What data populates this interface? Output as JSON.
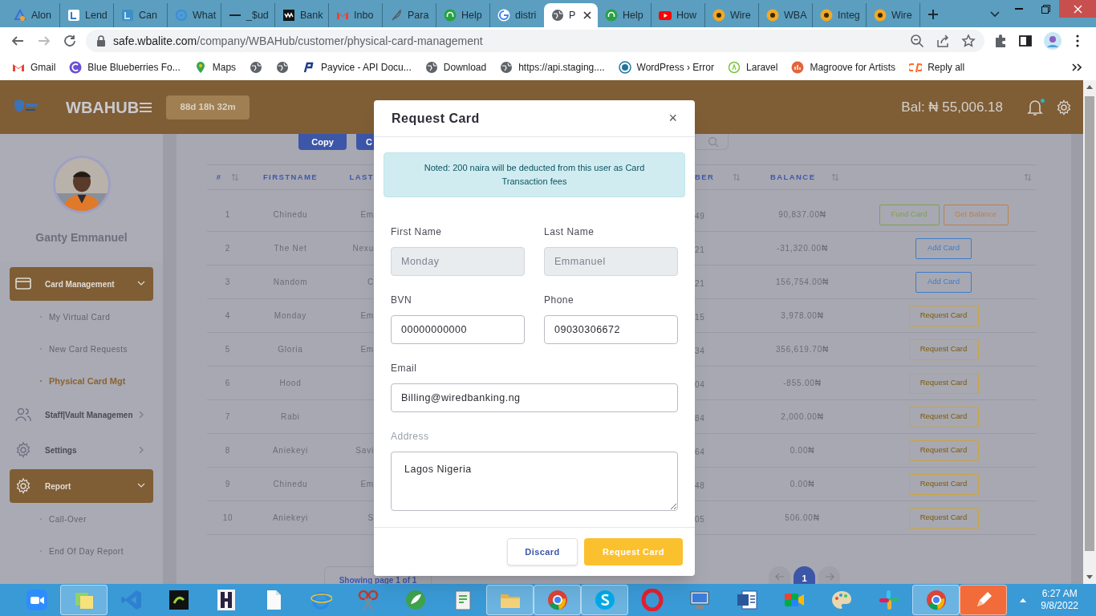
{
  "browser": {
    "tabs": [
      {
        "title": "Alon",
        "selected": false
      },
      {
        "title": "Lend",
        "selected": false
      },
      {
        "title": "Can",
        "selected": false
      },
      {
        "title": "What",
        "selected": false
      },
      {
        "title": "_$ud",
        "selected": false
      },
      {
        "title": "Bank",
        "selected": false
      },
      {
        "title": "Inbo",
        "selected": false
      },
      {
        "title": "Para",
        "selected": false
      },
      {
        "title": "Help",
        "selected": false
      },
      {
        "title": "distri",
        "selected": false
      },
      {
        "title": "P",
        "selected": true
      },
      {
        "title": "Help",
        "selected": false
      },
      {
        "title": "How",
        "selected": false
      },
      {
        "title": "Wire",
        "selected": false
      },
      {
        "title": "WBA",
        "selected": false
      },
      {
        "title": "Integ",
        "selected": false
      },
      {
        "title": "Wire",
        "selected": false
      }
    ],
    "url": {
      "host": "safe.wbalite.com",
      "path": "/company/WBAHub/customer/physical-card-management"
    },
    "bookmarks": [
      {
        "kind": "link",
        "label": "Gmail"
      },
      {
        "kind": "link",
        "label": "Blue Blueberries Fo..."
      },
      {
        "kind": "link",
        "label": "Maps"
      },
      {
        "kind": "icon"
      },
      {
        "kind": "icon"
      },
      {
        "kind": "link",
        "label": "Payvice - API Docu..."
      },
      {
        "kind": "link",
        "label": "Download"
      },
      {
        "kind": "link",
        "label": "https://api.staging...."
      },
      {
        "kind": "link",
        "label": "WordPress › Error"
      },
      {
        "kind": "link",
        "label": "Laravel"
      },
      {
        "kind": "link",
        "label": "Magroove for Artists"
      },
      {
        "kind": "link",
        "label": "Reply all"
      }
    ]
  },
  "app": {
    "brand": "WBAHUB",
    "timer": "88d 18h 32m",
    "balance": "Bal: ₦ 55,006.18",
    "notification": true
  },
  "sidebar": {
    "user": "Ganty Emmanuel",
    "items": [
      {
        "label": "Card Management",
        "expanded": true,
        "children": [
          {
            "label": "My Virtual Card",
            "selected": false
          },
          {
            "label": "New Card Requests",
            "selected": false
          },
          {
            "label": "Physical Card Mgt",
            "selected": true
          }
        ]
      },
      {
        "label": "Staff|Vault Managemen",
        "expanded": false
      },
      {
        "label": "Settings",
        "expanded": false
      },
      {
        "label": "Report",
        "expanded": true,
        "children": [
          {
            "label": "Call-Over",
            "selected": false
          },
          {
            "label": "End Of Day Report",
            "selected": false
          }
        ]
      }
    ]
  },
  "toolbar": {
    "buttons": [
      "Copy",
      "C"
    ]
  },
  "table": {
    "columns": [
      "#",
      "FIRSTNAME",
      "LAST",
      "BER",
      "BALANCE"
    ],
    "rows": [
      {
        "no": "1",
        "firstname": "Chinedu",
        "lastname": "Em",
        "column_4": "49",
        "balance": "90,837.00₦",
        "actions": [
          {
            "kind": "fund",
            "label": "Fund Card"
          },
          {
            "kind": "balance",
            "label": "Get Balance"
          }
        ]
      },
      {
        "no": "2",
        "firstname": "The Net",
        "lastname": "Nexu",
        "column_4": "21",
        "balance": "-31,320.00₦",
        "actions": [
          {
            "kind": "add",
            "label": "Add Card"
          }
        ]
      },
      {
        "no": "3",
        "firstname": "Nandom",
        "lastname": "C",
        "column_4": "21",
        "balance": "156,754.00₦",
        "actions": [
          {
            "kind": "add",
            "label": "Add Card"
          }
        ]
      },
      {
        "no": "4",
        "firstname": "Monday",
        "lastname": "Em",
        "column_4": "15",
        "balance": "3,978.00₦",
        "actions": [
          {
            "kind": "request",
            "label": "Request Card"
          }
        ]
      },
      {
        "no": "5",
        "firstname": "Gloria",
        "lastname": "Em",
        "column_4": "34",
        "balance": "356,619.70₦",
        "actions": [
          {
            "kind": "request",
            "label": "Request Card"
          }
        ]
      },
      {
        "no": "6",
        "firstname": "Hood",
        "column_4": "04",
        "balance": "-855.00₦",
        "actions": [
          {
            "kind": "request",
            "label": "Request Card"
          }
        ]
      },
      {
        "no": "7",
        "firstname": "Rabi",
        "column_4": "84",
        "balance": "2,000.00₦",
        "actions": [
          {
            "kind": "request",
            "label": "Request Card"
          }
        ]
      },
      {
        "no": "8",
        "firstname": "Aniekeyi",
        "lastname": "Savi",
        "column_4": "64",
        "balance": "0.00₦",
        "actions": [
          {
            "kind": "request",
            "label": "Request Card"
          }
        ]
      },
      {
        "no": "9",
        "firstname": "Chinedu",
        "lastname": "Em",
        "column_4": "48",
        "balance": "0.00₦",
        "actions": [
          {
            "kind": "request",
            "label": "Request Card"
          }
        ]
      },
      {
        "no": "10",
        "firstname": "Aniekeyi",
        "lastname": "S",
        "column_4": "05",
        "balance": "506.00₦",
        "actions": [
          {
            "kind": "request",
            "label": "Request Card"
          }
        ]
      }
    ]
  },
  "footer": {
    "showing": "Showing page 1 of 1",
    "pages": [
      {
        "label": "1",
        "selected": true
      }
    ]
  },
  "modal": {
    "title": "Request Card",
    "close": "×",
    "note": "Noted: 200 naira will be deducted from this user as Card Transaction fees",
    "fields": [
      {
        "label": "First Name",
        "value": "Monday",
        "disabled": true
      },
      {
        "label": "Last Name",
        "value": "Emmanuel",
        "disabled": true
      },
      {
        "label": "BVN",
        "value": "00000000000",
        "disabled": false
      },
      {
        "label": "Phone",
        "value": "09030306672",
        "disabled": false
      },
      {
        "label": "Email",
        "value": "Billing@wiredbanking.ng",
        "disabled": false,
        "kind": "wide"
      },
      {
        "label": "Address",
        "value": "Lagos Nigeria",
        "disabled": false,
        "kind": "textarea"
      }
    ],
    "buttons": [
      {
        "kind": "secondary",
        "label": "Discard"
      },
      {
        "kind": "primary",
        "label": "Request Card"
      }
    ]
  },
  "taskbar": {
    "apps": [
      {
        "open": false
      },
      {
        "open": true
      },
      {
        "open": false
      },
      {
        "open": false
      },
      {
        "open": false
      },
      {
        "open": false
      },
      {
        "open": false
      },
      {
        "open": false
      },
      {
        "open": false
      },
      {
        "open": false
      },
      {
        "open": true
      },
      {
        "open": true
      },
      {
        "open": true
      },
      {
        "open": false
      },
      {
        "open": false
      },
      {
        "open": false
      },
      {
        "open": false
      },
      {
        "open": false
      },
      {
        "open": false
      },
      {
        "open": true
      },
      {
        "open": true
      }
    ],
    "time": "6:27 AM",
    "date": "9/8/2022"
  }
}
